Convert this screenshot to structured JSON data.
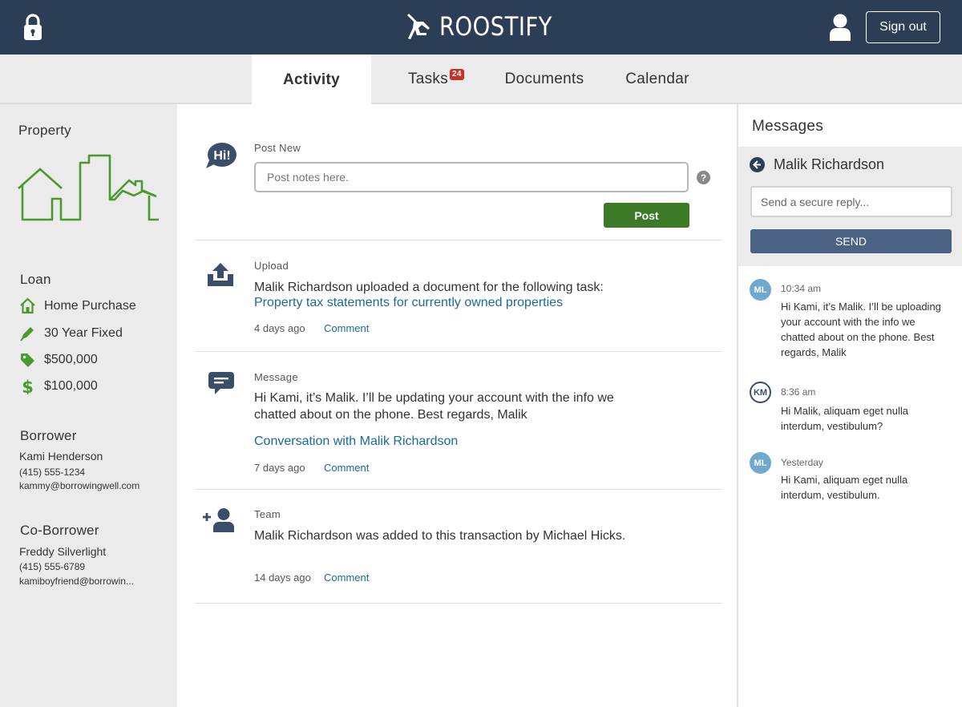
{
  "header": {
    "app_name": "ROOSTIFY",
    "signout_label": "Sign out"
  },
  "tabs": [
    {
      "label": "Activity",
      "active": true
    },
    {
      "label": "Tasks",
      "badge": "24"
    },
    {
      "label": "Documents"
    },
    {
      "label": "Calendar"
    }
  ],
  "sidebar": {
    "property_heading": "Property",
    "loan_heading": "Loan",
    "loan_items": [
      {
        "icon": "home-icon",
        "label": "Home Purchase"
      },
      {
        "icon": "pen-icon",
        "label": "30 Year Fixed"
      },
      {
        "icon": "tag-icon",
        "label": "$500,000"
      },
      {
        "icon": "dollar-icon",
        "label": "$100,000"
      }
    ],
    "borrower": {
      "heading": "Borrower",
      "name": "Kami Henderson",
      "phone": "(415) 555-1234",
      "email": "kammy@borrowingwell.com"
    },
    "coborrower": {
      "heading": "Co-Borrower",
      "name": "Freddy Silverlight",
      "phone": "(415) 555-6789",
      "email": "kamiboyfriend@borrowin..."
    }
  },
  "feed": {
    "post": {
      "label": "Post New",
      "placeholder": "Post notes here.",
      "button": "Post",
      "hi_icon_text": "Hi!"
    },
    "items": [
      {
        "kind": "Upload",
        "body": "Malik Richardson uploaded a document for the following task:",
        "link": "Property tax statements for currently owned properties",
        "time": "4 days ago",
        "comment": "Comment"
      },
      {
        "kind": "Message",
        "body": "Hi Kami, it’s Malik. I’ll be updating your account with the info we chatted about on the phone. Best regards, Malik",
        "link": "Conversation with Malik Richardson",
        "time": "7 days ago",
        "comment": "Comment"
      },
      {
        "kind": "Team",
        "body": "Malik Richardson was added to this transaction by Michael Hicks.",
        "time": "14 days ago",
        "comment": "Comment"
      }
    ]
  },
  "messages": {
    "title": "Messages",
    "contact": "Malik Richardson",
    "reply_placeholder": "Send a secure reply...",
    "send_label": "SEND",
    "thread": [
      {
        "initials": "ML",
        "time": "10:34 am",
        "text": "Hi Kami, it’s Malik. I’ll be uploading your account with the info we chatted about on the phone. Best regards, Malik"
      },
      {
        "initials": "KM",
        "time": "8:36 am",
        "text": "Hi Malik, aliquam eget nulla interdum, vestibulum?"
      },
      {
        "initials": "ML",
        "time": "Yesterday",
        "text": "Hi Kami, aliquam eget nulla interdum, vestibulum."
      }
    ]
  },
  "colors": {
    "header_bg": "#2c3e56",
    "accent_green": "#3d7a28",
    "link_blue": "#1a6a9a",
    "send_button": "#4a6385",
    "badge_red": "#c9302c"
  }
}
